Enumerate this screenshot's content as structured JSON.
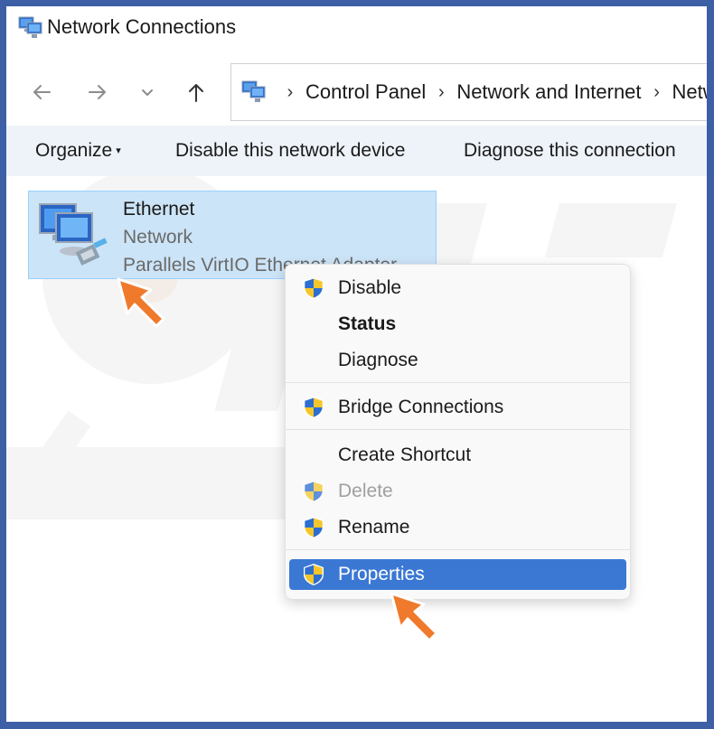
{
  "window": {
    "title": "Network Connections"
  },
  "nav": {
    "back_icon": "arrow-left-icon",
    "forward_icon": "arrow-right-icon",
    "recent_icon": "chevron-down-icon",
    "up_icon": "arrow-up-icon"
  },
  "address": {
    "crumbs": [
      "Control Panel",
      "Network and Internet",
      "Network Connections"
    ],
    "separator": "›"
  },
  "toolbar": {
    "organize": "Organize",
    "disable": "Disable this network device",
    "diagnose": "Diagnose this connection"
  },
  "item": {
    "name": "Ethernet",
    "type": "Network",
    "adapter": "Parallels VirtIO Ethernet Adapter"
  },
  "menu": {
    "disable": "Disable",
    "status": "Status",
    "diagnose": "Diagnose",
    "bridge": "Bridge Connections",
    "shortcut": "Create Shortcut",
    "delete": "Delete",
    "rename": "Rename",
    "properties": "Properties"
  },
  "colors": {
    "frame": "#3d5fa6",
    "selection": "#cce4f7",
    "menu_highlight": "#3a78d4",
    "arrow": "#f07a2c"
  }
}
